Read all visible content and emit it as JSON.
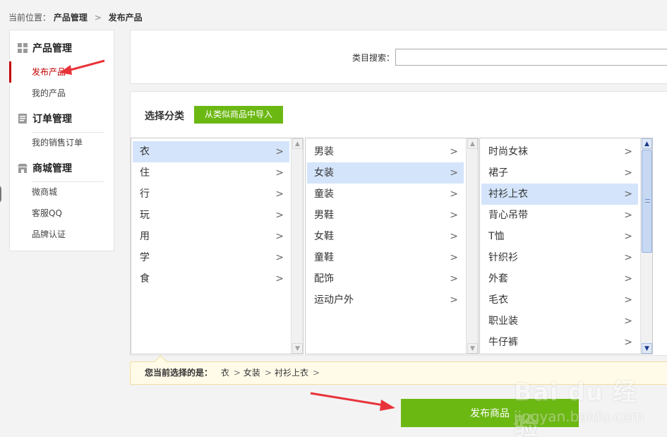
{
  "breadcrumb": {
    "prefix": "当前位置：",
    "level1": "产品管理",
    "separator": ">",
    "level2": "发布产品"
  },
  "sidebar": {
    "groups": [
      {
        "title": "产品管理",
        "icon": "product-grid-icon",
        "items": [
          "发布产品",
          "我的产品"
        ]
      },
      {
        "title": "订单管理",
        "icon": "order-document-icon",
        "items": [
          "我的销售订单"
        ]
      },
      {
        "title": "商城管理",
        "icon": "store-awning-icon",
        "items": [
          "微商城",
          "客服QQ",
          "品牌认证"
        ]
      }
    ],
    "active_item": "发布产品",
    "active_color": "#c30000"
  },
  "search": {
    "label": "类目搜索：",
    "value": "",
    "placeholder": ""
  },
  "category": {
    "title": "选择分类",
    "import_button": "从类似商品中导入",
    "chevron": ">",
    "column1": [
      "衣",
      "住",
      "行",
      "玩",
      "用",
      "学",
      "食"
    ],
    "column2": [
      "男装",
      "女装",
      "童装",
      "男鞋",
      "女鞋",
      "童鞋",
      "配饰",
      "运动户外"
    ],
    "column3": [
      "时尚女袜",
      "裙子",
      "衬衫上衣",
      "背心吊带",
      "T恤",
      "针织衫",
      "外套",
      "毛衣",
      "职业装",
      "牛仔裤"
    ],
    "selected": [
      "衣",
      "女装",
      "衬衫上衣"
    ],
    "scroll_up": "▲",
    "scroll_down": "▼"
  },
  "selection": {
    "label": "您当前选择的是：",
    "path": [
      "衣",
      "女装",
      "衬衫上衣"
    ],
    "separator": ">"
  },
  "publish_button": "发布商品",
  "watermark": {
    "brand": "Bai du 经验",
    "url": "jingyan.baidu.com"
  },
  "colors": {
    "accent_green": "#6cb813",
    "selected_bg": "#d4e4fb",
    "annotation_red": "#e8333a"
  }
}
